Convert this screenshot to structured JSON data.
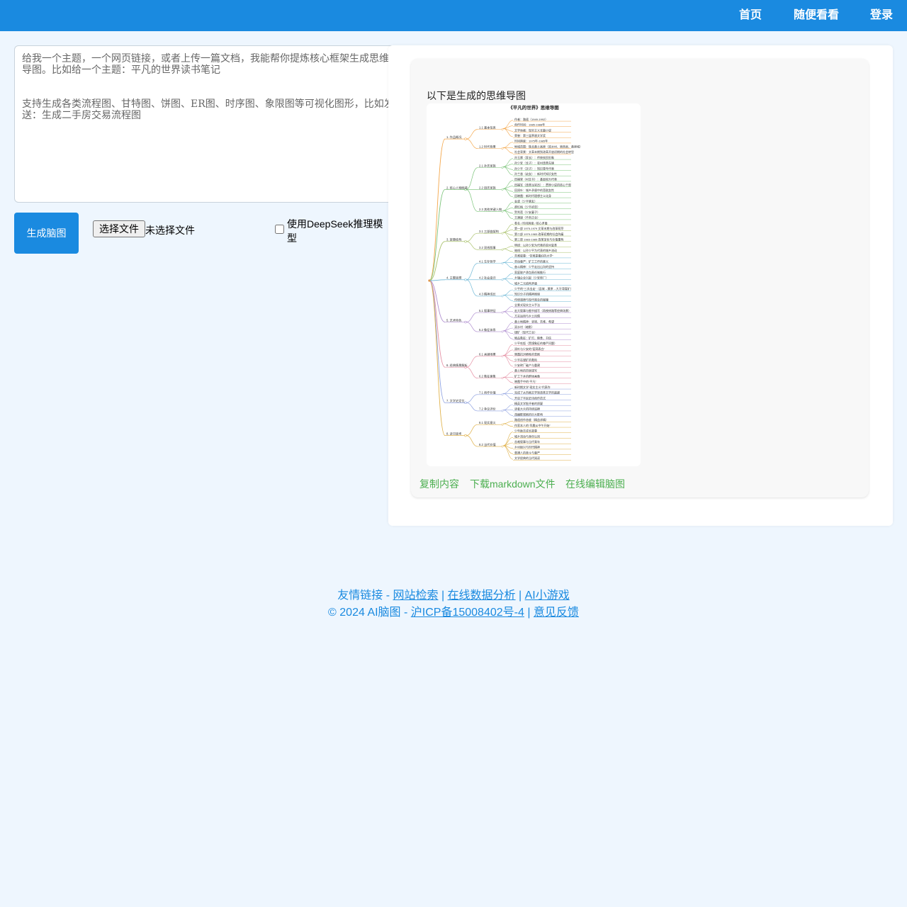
{
  "nav": {
    "home": "首页",
    "browse": "随便看看",
    "login": "登录"
  },
  "prompt": {
    "text": "给我一个主题，一个网页链接，或者上传一篇文档，我能帮你提炼核心框架生成思维\n导图。比如给一个主题：平凡的世界读书笔记\n\n\n支持生成各类流程图、甘特图、饼图、ER图、时序图、象限图等可视化图形，比如发\n送：生成二手房交易流程图"
  },
  "controls": {
    "generate": "生成脑图",
    "choose_file": "选择文件",
    "no_file": "未选择文件",
    "deepseek": "使用DeepSeek推理模型",
    "deepseek_checked": false
  },
  "result": {
    "title": "以下是生成的思维导图",
    "mindmap": {
      "root": "《平凡的世界》思维导图",
      "branches": [
        {
          "label": "1. 作品概况",
          "subs": [
            {
              "label": "1.1 基本信息",
              "leaves": [
                "作者：路遥（1949-1992）",
                "创作时间：1985-1988年",
                "文学体裁：现实主义长篇小说",
                "荣誉：第三届茅盾文学奖"
              ]
            },
            {
              "label": "1.2 时代背景",
              "leaves": [
                "时间跨度：1975年-1985年",
                "地域范围：陕北黄土高原（双水村、原西县、黄原城）",
                "社会背景：文革末期到改革开放初期的社会转型"
              ]
            }
          ]
        },
        {
          "label": "2. 核心人物图谱",
          "subs": [
            {
              "label": "2.1 孙氏家族",
              "leaves": [
                "孙玉厚（家长）：传统农民形象",
                "孙少安（长子）：农村改革先锋",
                "孙少平（次子）：知识青年代表",
                "孙兰香（幼女）：新时代知识女性"
              ]
            },
            {
              "label": "2.2 田氏家族",
              "leaves": [
                "田福堂（村支书）：基层权力代表",
                "田福军（改革派官员）：贯穿小说的核心干部",
                "田润叶：城乡矛盾中的悲剧女性",
                "田晓霞：新时代理想主义化身"
              ]
            },
            {
              "label": "2.3 其他关键人物",
              "leaves": [
                "金波（少平挚友）",
                "郝红梅（少平初恋）",
                "贺秀莲（少安妻子）",
                "王满银（不务正业）"
              ]
            }
          ]
        },
        {
          "label": "3. 故事结构",
          "subs": [
            {
              "label": "3.1 三部曲架构",
              "leaves": [
                "卷名 / 时间跨度 / 核心矛盾",
                "第一部 1975-1979 文革末期与改革萌芽",
                "第二部 1979-1983 改革初期的社会阵痛",
                "第三部 1983-1985 改革深化与价值重构"
              ]
            },
            {
              "label": "3.2 双线叙事",
              "leaves": [
                "明线：以孙少安为代表的农村变革",
                "暗线：以孙少平为代表的城乡流动"
              ]
            }
          ]
        },
        {
          "label": "4. 主题思想",
          "subs": [
            {
              "label": "4.1 生存哲学",
              "leaves": [
                "苦难叙事：“苦难是最好的大学”",
                "劳动尊严：矿工工作的意义",
                "奋斗精神：少平走出山沟的坚持"
              ]
            },
            {
              "label": "4.2 社会变迁",
              "leaves": [
                "家庭联产承包责任制推行",
                "乡镇企业兴起（少安砖厂）",
                "城乡二元结构矛盾"
              ]
            },
            {
              "label": "4.3 精神成长",
              "leaves": [
                "少平的“三次出走”（县城→黄原→大牙湾煤矿）",
                "知识分子的精神困境",
                "传统道德与现代观念的碰撞"
              ]
            }
          ]
        },
        {
          "label": "5. 艺术特色",
          "subs": [
            {
              "label": "5.1 叙事特征",
              "leaves": [
                "全景式现实主义手法",
                "宏大叙事与细节描写（雨夜修路等经典场景）",
                "方言运用与乡土风情"
              ]
            },
            {
              "label": "5.2 象征体系",
              "leaves": [
                "黄土地精神：坚韧、苦难、希望",
                "双水村（缩影）",
                "煤矿（现代工业）",
                "物品象征：矿灯、粮食、书信"
              ]
            }
          ]
        },
        {
          "label": "6. 经典情景解析",
          "subs": [
            {
              "label": "6.1 关键场景",
              "leaves": [
                "少平吃饭（黑馍象征的尊严问题）",
                "润叶与少安的“窑洞表白”",
                "晓霞抗洪牺牲的悲剧",
                "少平在煤矿的救险",
                "少安砖厂破产与重建"
              ]
            },
            {
              "label": "6.2 象征意象",
              "leaves": [
                "黄土地的四季描写",
                "矿工下井的群体画像",
                "晓霞手中的“平凡”"
              ]
            }
          ]
        },
        {
          "label": "7. 文学史定位",
          "subs": [
            {
              "label": "7.1 创作价值",
              "leaves": [
                "新时期文学“现实主义”代表作",
                "完成了从伤痕文学到改革文学的超越",
                "开启了平民史诗创作范式"
              ]
            },
            {
              "label": "7.2 争议评价",
              "leaves": [
                "精英文学批评者的质疑",
                "读者大众的持续追捧",
                "改编影视剧的巨大影响"
              ]
            }
          ]
        },
        {
          "label": "8. 读书思考",
          "subs": [
            {
              "label": "8.1 现实意义",
              "leaves": [
                "路遥创作态度（精益求精）",
                "作家本人的“早晨从中午开始”"
              ]
            },
            {
              "label": "8.2 当代价值",
              "leaves": [
                "少年励志成长故事",
                "城乡流动与身份认同",
                "苦难叙事与当代青年",
                "乡村振兴与时代精神",
                "普通人的奋斗与尊严",
                "文学经典的当代阅读"
              ]
            }
          ]
        }
      ]
    },
    "links": {
      "copy": "复制内容",
      "download": "下载markdown文件",
      "edit": "在线编辑脑图"
    }
  },
  "footer": {
    "friends_prefix": "友情链接 - ",
    "link1": "网站检索",
    "sep": " | ",
    "link2": "在线数据分析",
    "link3": "AI小游戏",
    "copyright_prefix": "© 2024 AI脑图 - ",
    "icp": "沪ICP备15008402号-4",
    "feedback": "意见反馈"
  },
  "colors": {
    "primary": "#1a8ae0",
    "page_bg": "#eef6fe",
    "link_green": "#4caf50",
    "mindmap_branches": [
      "#f4a74b",
      "#7cc47a",
      "#a9c16b",
      "#6fb8d6",
      "#b08fd0",
      "#e58fa3",
      "#8fa2e0",
      "#e0b24b"
    ]
  }
}
